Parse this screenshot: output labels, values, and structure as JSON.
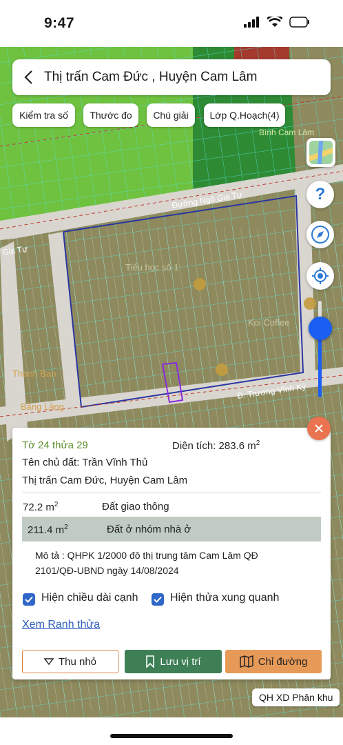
{
  "status_bar": {
    "time": "9:47"
  },
  "header": {
    "title": "Thị trấn Cam Đức , Huyện Cam Lâm"
  },
  "chips": [
    {
      "label": "Kiểm tra số"
    },
    {
      "label": "Thước đo"
    },
    {
      "label": "Chú giải"
    },
    {
      "label": "Lớp Q.Hoạch(4)"
    }
  ],
  "map": {
    "street_labels": [
      "Đường Ngô Gia Tự",
      "Đ. Trương Vĩnh Ký",
      "Gia Tự",
      "Tiểu học số 1",
      "Koi Coffee",
      "Thanh Ban",
      "Bằng Lăng",
      "Bình Cam Lâm"
    ],
    "colors": {
      "land": "#8e8a5e",
      "green_zone": "#6fc23f",
      "dark_green_zone": "#2e8b34",
      "red_zone": "#a43a2e",
      "road": "#d9d6d0"
    }
  },
  "parcel": {
    "id_text": "Tờ 24 thửa 29",
    "area_label": "Diện tích: 283.6 m",
    "area_sup": "2",
    "owner": "Tên chủ đất: Trần Vĩnh Thủ",
    "address": "Thị trấn Cam Đức, Huyện Cam Lâm",
    "uses": [
      {
        "area": "72.2 m",
        "sup": "2",
        "type": "Đất giao thông"
      },
      {
        "area": "211.4 m",
        "sup": "2",
        "type": "Đất ở nhóm nhà ở"
      }
    ],
    "description_line1": "Mô tả : QHPK 1/2000 đô thị trung tâm Cam Lâm QĐ",
    "description_line2": "2101/QĐ-UBND ngày 14/08/2024",
    "checkbox_edges": "Hiện chiều dài cạnh",
    "checkbox_neighbors": "Hiện thửa xung quanh",
    "link": "Xem Ranh thửa",
    "btn_shrink": "Thu nhỏ",
    "btn_save": "Lưu vị trí",
    "btn_directions": "Chỉ đường"
  },
  "map_tag": "QH XD Phân khu"
}
